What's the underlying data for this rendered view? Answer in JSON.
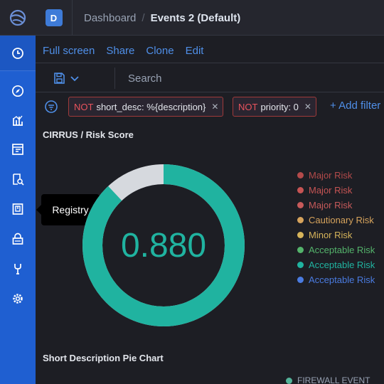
{
  "header": {
    "space_initial": "D",
    "breadcrumb_parent": "Dashboard",
    "breadcrumb_separator": "/",
    "breadcrumb_current": "Events 2 (Default)"
  },
  "sidebar": {
    "items": [
      {
        "icon": "clock-icon"
      },
      {
        "icon": "compass-icon"
      },
      {
        "icon": "visualize-icon"
      },
      {
        "icon": "dashboard-icon"
      },
      {
        "icon": "discover-icon"
      },
      {
        "icon": "registry-icon"
      },
      {
        "icon": "lock-icon"
      },
      {
        "icon": "wrench-icon"
      },
      {
        "icon": "gear-icon"
      }
    ],
    "tooltip": "Registry"
  },
  "actions": {
    "full_screen": "Full screen",
    "share": "Share",
    "clone": "Clone",
    "edit": "Edit"
  },
  "search": {
    "placeholder": "Search"
  },
  "filters": [
    {
      "negation": "NOT",
      "text": "short_desc: %{description}"
    },
    {
      "negation": "NOT",
      "text": "priority: 0"
    }
  ],
  "add_filter": "+ Add filter",
  "panel": {
    "title": "CIRRUS / Risk Score",
    "value": "0.880",
    "gauge_fraction": 0.88,
    "value_color": "#20b3a0",
    "track_color": "#d6d9de",
    "legend": [
      {
        "label": "Major Risk",
        "color": "#b34a4a"
      },
      {
        "label": "Major Risk",
        "color": "#c65454"
      },
      {
        "label": "Major Risk",
        "color": "#c75a5a"
      },
      {
        "label": "Cautionary Risk",
        "color": "#d6a35c"
      },
      {
        "label": "Minor Risk",
        "color": "#d6b45a"
      },
      {
        "label": "Acceptable Risk",
        "color": "#54b36b"
      },
      {
        "label": "Acceptable Risk",
        "color": "#20b3a0"
      },
      {
        "label": "Acceptable Risk",
        "color": "#4a7be0"
      }
    ]
  },
  "panel2": {
    "title": "Short Description Pie Chart",
    "legend_first": "FIREWALL EVENT"
  }
}
